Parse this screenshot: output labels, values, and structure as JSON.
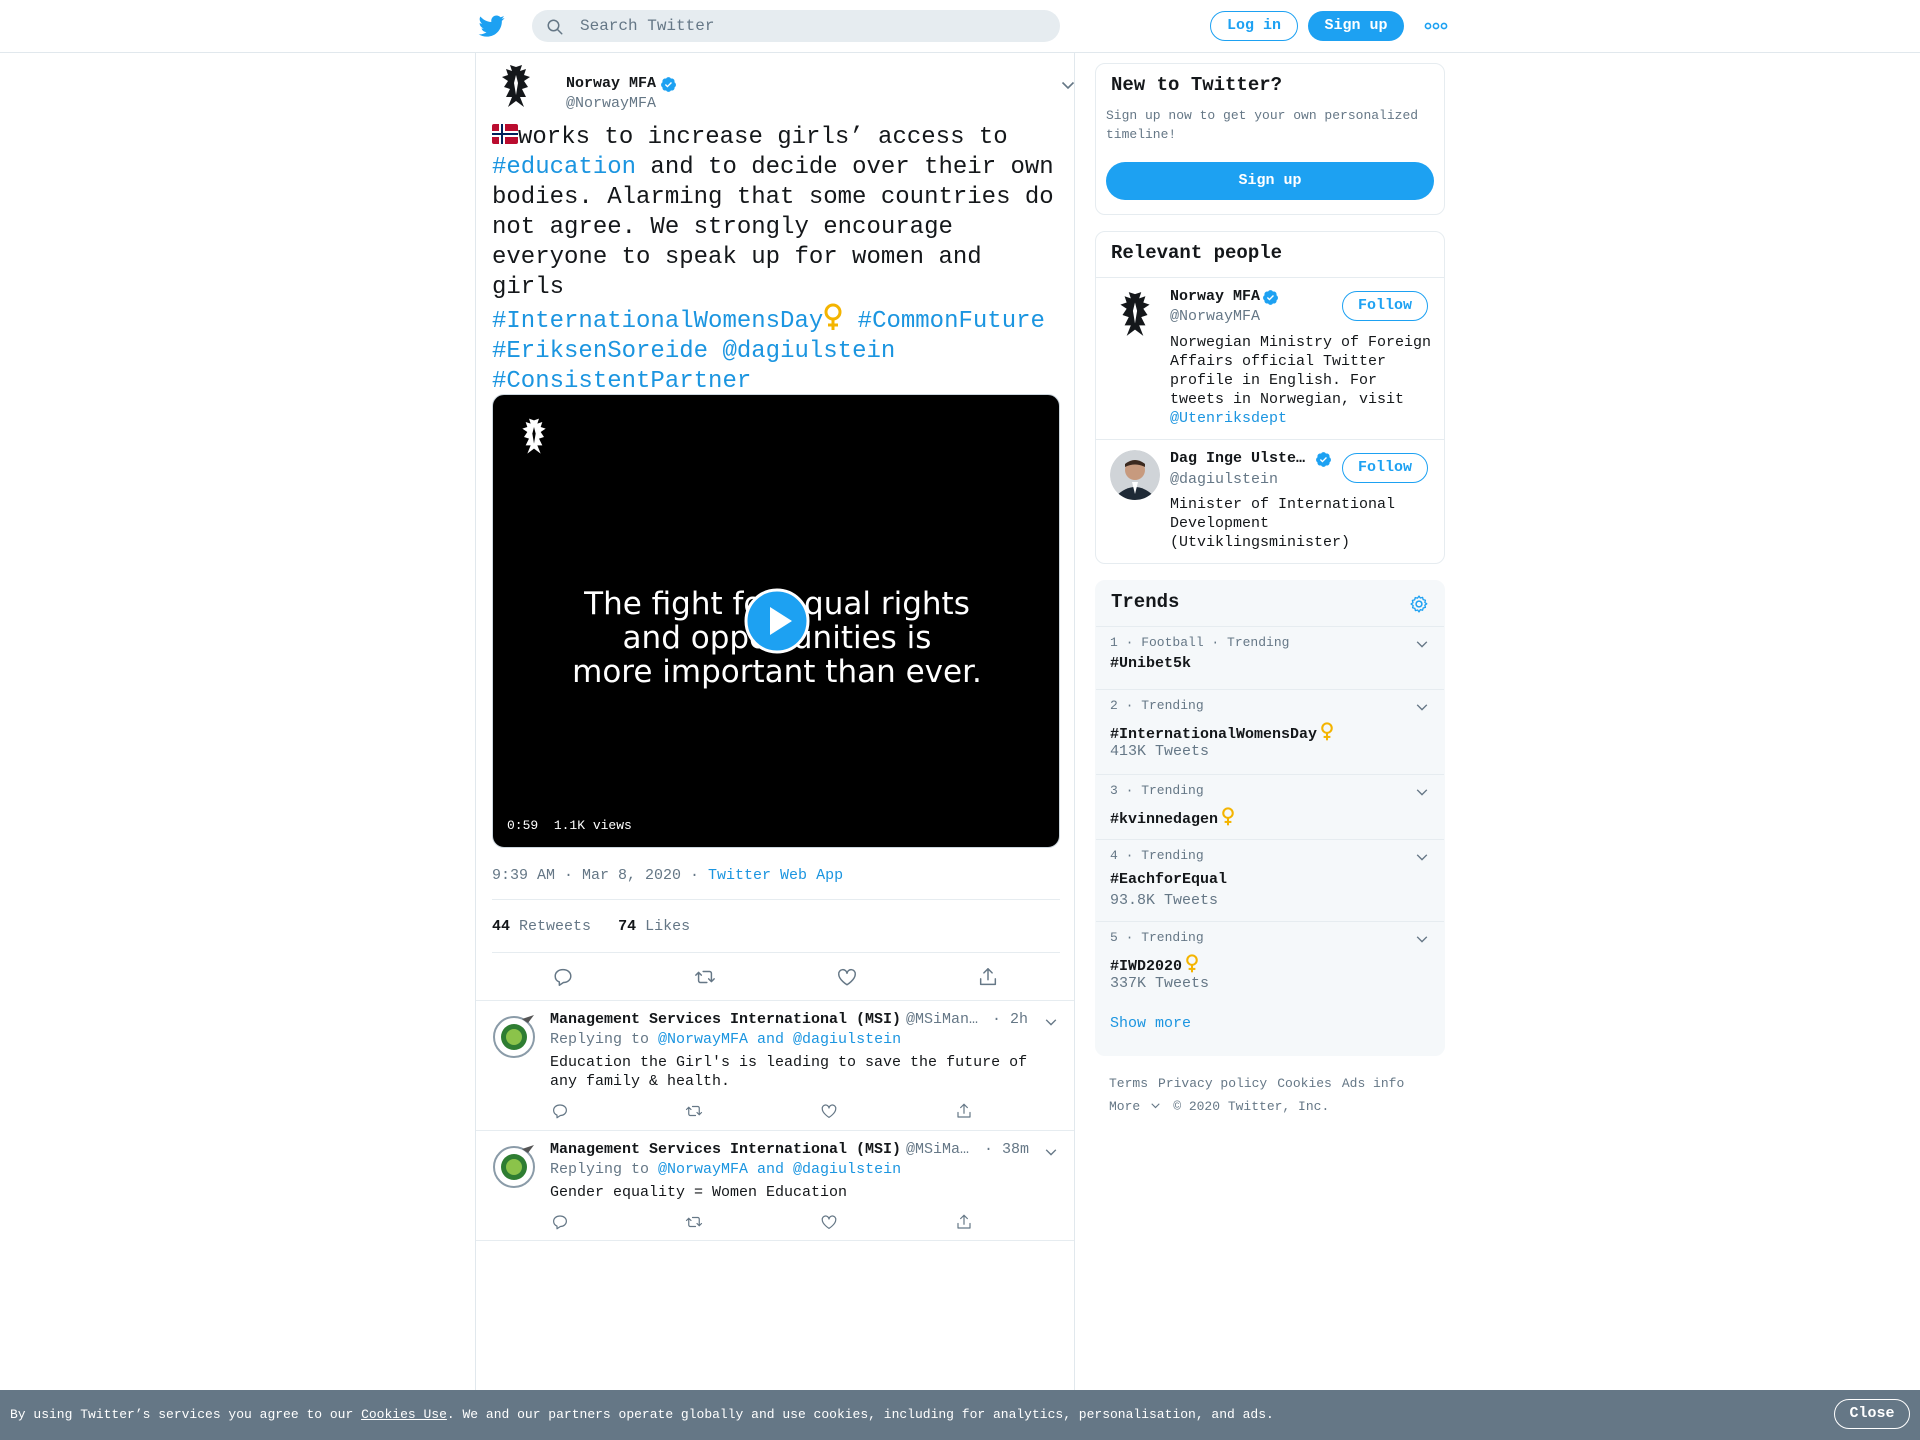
{
  "topbar": {
    "search_placeholder": "Search Twitter",
    "login_label": "Log in",
    "signup_label": "Sign up"
  },
  "tweet": {
    "author_name": "Norway MFA",
    "author_handle": "@NorwayMFA",
    "text_part1": "works to increase girls’ access to",
    "hashtag_education": "#education",
    "text_part2": " and to decide over their own bodies. Alarming that some countries do not agree. We strongly encourage everyone to speak up for women and girls",
    "hashtag_iwd": "#InternationalWomensDay",
    "hashtag_commonfuture": "#CommonFuture",
    "hashtag_eriksen": "#EriksenSoreide",
    "mention_dag": "@dagiulstein",
    "hashtag_consistent": "#ConsistentPartner",
    "video_caption": "The fight for equal rights\nand opportunities is\nmore important than ever.",
    "video_duration": "0:59",
    "video_views": "1.1K views",
    "time": "9:39 AM · Mar 8, 2020",
    "source": "Twitter Web App",
    "retweets_count": "44",
    "retweets_label": "Retweets",
    "likes_count": "74",
    "likes_label": "Likes"
  },
  "replies": [
    {
      "name": "Management Services International (MSI)",
      "handle": "@MSiMan…",
      "time": "· 2h",
      "replying_to_prefix": "Replying to ",
      "replying_to": "@NorwayMFA and @dagiulstein",
      "text": "Education the Girl's is leading to save the future of any family & health."
    },
    {
      "name": "Management Services International (MSI)",
      "handle": "@MSiMa…",
      "time": "· 38m",
      "replying_to_prefix": "Replying to ",
      "replying_to": "@NorwayMFA and @dagiulstein",
      "text": "Gender equality = Women Education"
    }
  ],
  "new_to_twitter": {
    "title": "New to Twitter?",
    "description": "Sign up now to get your own personalized timeline!",
    "signup_label": "Sign up"
  },
  "relevant_people": {
    "title": "Relevant people",
    "people": [
      {
        "name": "Norway MFA",
        "handle": "@NorwayMFA",
        "bio": "Norwegian Ministry of Foreign Affairs official Twitter profile in English. For tweets in Norwegian, visit ",
        "bio_link": "@Utenriksdept",
        "follow_label": "Follow"
      },
      {
        "name": "Dag Inge Ulste…",
        "handle": "@dagiulstein",
        "bio": "Minister of International Development (Utviklingsminister)",
        "follow_label": "Follow"
      }
    ]
  },
  "trends": {
    "title": "Trends",
    "items": [
      {
        "meta": "1 · Football · Trending",
        "name": "#Unibet5k",
        "count": ""
      },
      {
        "meta": "2 · Trending",
        "name": "#InternationalWomensDay",
        "count": "413K Tweets"
      },
      {
        "meta": "3 · Trending",
        "name": "#kvinnedagen",
        "count": ""
      },
      {
        "meta": "4 · Trending",
        "name": "#EachforEqual",
        "count": "93.8K Tweets"
      },
      {
        "meta": "5 · Trending",
        "name": "#IWD2020",
        "count": "337K Tweets"
      }
    ],
    "show_more": "Show more"
  },
  "footer": {
    "links": [
      "Terms",
      "Privacy policy",
      "Cookies",
      "Ads info"
    ],
    "more": "More",
    "copyright": "© 2020 Twitter, Inc."
  },
  "cookie_bar": {
    "text_before": "By using Twitter’s services you agree to our ",
    "link": "Cookies Use",
    "text_after": ". We and our partners operate globally and use cookies, including for analytics, personalisation, and ads.",
    "close_label": "Close"
  },
  "colors": {
    "accent": "#1da1f2",
    "link": "#1b95e0",
    "secondary_text": "#657786",
    "cookie_bar": "#657786",
    "venus_gold": "#f4b400"
  },
  "icons": [
    "twitter-bird-icon",
    "search-icon",
    "more-dots-icon",
    "verified-icon",
    "chevron-down-icon",
    "play-icon",
    "reply-icon",
    "retweet-icon",
    "like-icon",
    "share-icon",
    "gear-icon",
    "norway-flag-icon",
    "venus-icon"
  ]
}
